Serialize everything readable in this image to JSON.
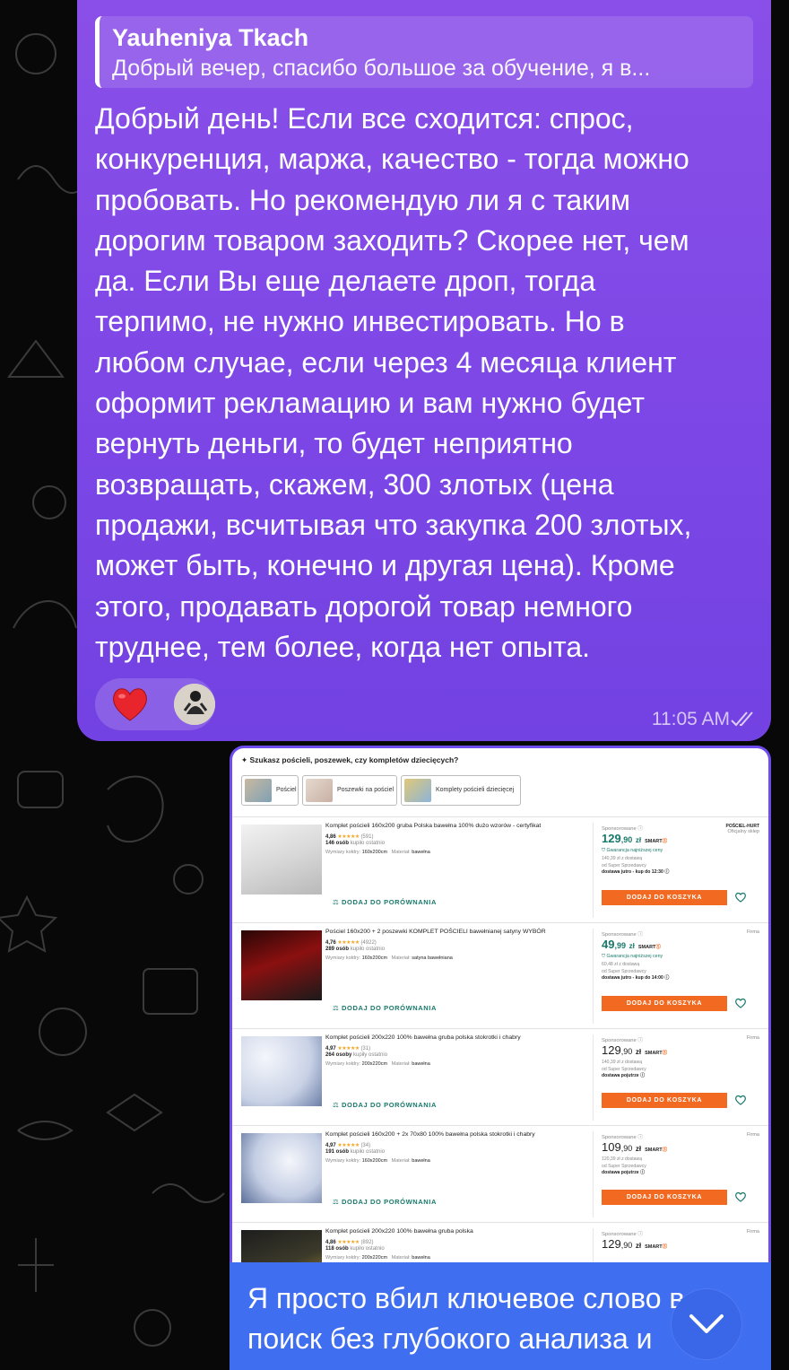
{
  "reply": {
    "author": "Yauheniya Tkach",
    "preview": "Добрый вечер, спасибо большое за обучение, я в..."
  },
  "message": {
    "lines": [
      "Добрый день! Если все сходится: спрос,",
      "конкуренция, маржа, качество - тогда можно",
      "пробовать. Но рекомендую ли я с таким",
      "дорогим товаром заходить? Скорее нет, чем",
      "да. Если Вы еще делаете дроп, тогда",
      "терпимо, не нужно инвестировать. Но в",
      "любом случае, если через 4 месяца клиент",
      "оформит рекламацию и вам нужно будет",
      "вернуть деньги, то будет неприятно",
      "возвращать, скажем, 300 злотых (цена",
      "продажи, всчитывая что закупка 200 злотых,",
      "может быть, конечно и другая цена). Кроме",
      "этого, продавать дорогой товар немного",
      "труднее, тем более, когда нет опыта."
    ],
    "time": "11:05 AM",
    "reactions": [
      "heart-emoji",
      "user-avatar"
    ]
  },
  "screenshot": {
    "header": "Szukasz pościeli, poszewek, czy kompletów dziecięcych?",
    "chips": [
      "Pościel",
      "Poszewki na pościel",
      "Komplety pościeli dziecięcej"
    ],
    "compare_label": "DODAJ DO PORÓWNANIA",
    "cart_label": "DODAJ DO KOSZYKA",
    "sponsored_label": "Sponsorowane ⓘ",
    "params_label": "Wymiary kołdry:",
    "material_label": "Materiał:",
    "listings": [
      {
        "title": "Komplet pościeli 160x200 gruba Polska bawełna 100% dużo wzorów - certyfikat",
        "rating": "4,86",
        "reviews": "(591)",
        "bought": "146 osób",
        "bought_suffix": "kupiło ostatnio",
        "size": "160x200cm",
        "material": "bawełna",
        "price_int": "129",
        "price_dec": ",90",
        "currency": "zł",
        "smart": "SMART",
        "price_green": true,
        "guarantee": "Gwarancja najniższej ceny",
        "delivery_price": "140,39 zł z dostawą",
        "super_seller": "od  Super Sprzedawcy",
        "delivery": "dostawa jutro - kup do 12:30 ⓘ",
        "seller_logo": "POŚCIEL-HURT",
        "seller_note": "Oficjalny sklep"
      },
      {
        "title": "Pościel 160x200 + 2 poszewki KOMPLET POŚCIELI bawełnianej satyny WYBÓR",
        "rating": "4,76",
        "reviews": "(4922)",
        "bought": "289 osób",
        "bought_suffix": "kupiło ostatnio",
        "size": "160x200cm",
        "material": "satyna bawełniana",
        "price_int": "49",
        "price_dec": ",99",
        "currency": "zł",
        "smart": "SMART",
        "price_green": true,
        "guarantee": "Gwarancja najniższej ceny",
        "delivery_price": "60,48 zł z dostawą",
        "super_seller": "od  Super Sprzedawcy",
        "delivery": "dostawa jutro - kup do 14:00 ⓘ",
        "seller_logo": "",
        "seller_note": "Firma"
      },
      {
        "title": "Komplet pościeli 200x220 100% bawełna gruba polska stokrotki i chabry",
        "rating": "4,97",
        "reviews": "(31)",
        "bought": "264 osoby",
        "bought_suffix": "kupiły ostatnio",
        "size": "200x220cm",
        "material": "bawełna",
        "price_int": "129",
        "price_dec": ",90",
        "currency": "zł",
        "smart": "SMART",
        "price_green": false,
        "guarantee": "",
        "delivery_price": "140,39 zł z dostawą",
        "super_seller": "od  Super Sprzedawcy",
        "delivery": "dostawa pojutrze ⓘ",
        "seller_logo": "",
        "seller_note": "Firma"
      },
      {
        "title": "Komplet pościeli 160x200 + 2x 70x80 100% bawełna polska stokrotki i chabry",
        "rating": "4,97",
        "reviews": "(34)",
        "bought": "191 osób",
        "bought_suffix": "kupiło ostatnio",
        "size": "160x200cm",
        "material": "bawełna",
        "price_int": "109",
        "price_dec": ",90",
        "currency": "zł",
        "smart": "SMART",
        "price_green": false,
        "guarantee": "",
        "delivery_price": "120,39 zł z dostawą",
        "super_seller": "od  Super Sprzedawcy",
        "delivery": "dostawa pojutrze ⓘ",
        "seller_logo": "",
        "seller_note": "Firma"
      },
      {
        "title": "Komplet pościeli 200x220 100% bawełna gruba polska",
        "rating": "4,86",
        "reviews": "(892)",
        "bought": "118 osób",
        "bought_suffix": "kupiło ostatnio",
        "size": "200x220cm",
        "material": "bawełna",
        "price_int": "129",
        "price_dec": ",90",
        "currency": "zł",
        "smart": "SMART",
        "price_green": false,
        "guarantee": "",
        "delivery_price": "",
        "super_seller": "",
        "delivery": "",
        "seller_logo": "",
        "seller_note": "Firma"
      }
    ]
  },
  "reply_message": {
    "lines": [
      "Я просто вбил ключевое слово в",
      "поиск без глубокого анализа и"
    ]
  },
  "colors": {
    "bubble_in": "#7c46e6",
    "bubble_out": "#3f6ef0",
    "allegro_orange": "#f26a21",
    "allegro_green": "#18796b"
  }
}
